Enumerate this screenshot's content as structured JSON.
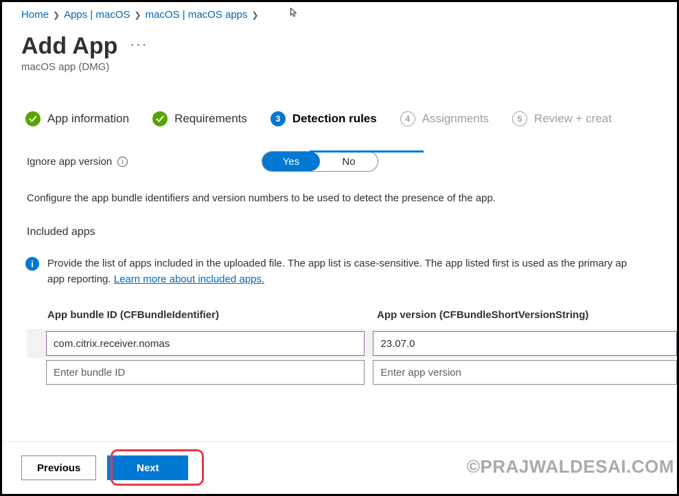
{
  "breadcrumb": {
    "items": [
      "Home",
      "Apps | macOS",
      "macOS | macOS apps"
    ]
  },
  "page": {
    "title": "Add App",
    "subtitle": "macOS app (DMG)"
  },
  "steps": {
    "s1": {
      "label": "App information"
    },
    "s2": {
      "label": "Requirements"
    },
    "s3": {
      "num": "3",
      "label": "Detection rules"
    },
    "s4": {
      "num": "4",
      "label": "Assignments"
    },
    "s5": {
      "num": "5",
      "label": "Review + creat"
    }
  },
  "detection": {
    "ignore_label": "Ignore app version",
    "toggle": {
      "yes": "Yes",
      "no": "No"
    },
    "description": "Configure the app bundle identifiers and version numbers to be used to detect the presence of the app.",
    "included_heading": "Included apps"
  },
  "info": {
    "text_a": "Provide the list of apps included in the uploaded file. The app list is case-sensitive. The app listed first is used as the primary ap",
    "text_b": "app reporting. ",
    "link": "Learn more about included apps."
  },
  "table": {
    "header_bundle": "App bundle ID (CFBundleIdentifier)",
    "header_version": "App version (CFBundleShortVersionString)",
    "rows": [
      {
        "bundle": "com.citrix.receiver.nomas",
        "version": "23.07.0"
      }
    ],
    "placeholder_bundle": "Enter bundle ID",
    "placeholder_version": "Enter app version"
  },
  "footer": {
    "previous": "Previous",
    "next": "Next"
  },
  "watermark": "©PRAJWALDESAI.COM"
}
